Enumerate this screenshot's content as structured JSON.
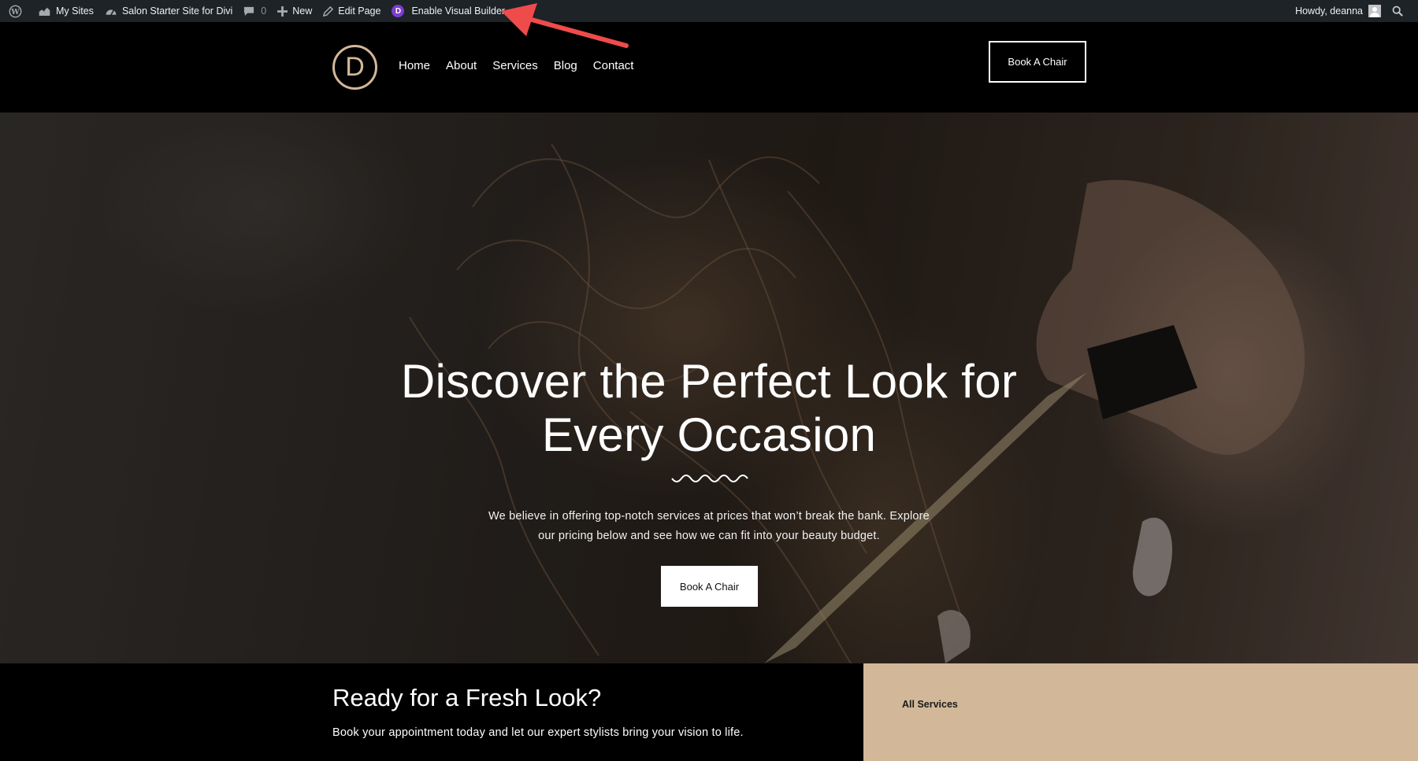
{
  "admin_bar": {
    "my_sites": "My Sites",
    "site_name": "Salon Starter Site for Divi",
    "comments_count": "0",
    "new": "New",
    "edit_page": "Edit Page",
    "divi_badge": "D",
    "visual_builder": "Enable Visual Builder",
    "greeting": "Howdy, deanna",
    "icons": [
      "wordpress-icon",
      "my-sites-icon",
      "dashboard-icon",
      "comment-icon",
      "plus-icon",
      "pencil-icon",
      "divi-icon",
      "avatar",
      "search-icon"
    ]
  },
  "annotation": {
    "color": "#ef4b4b",
    "shape": "arrow"
  },
  "header": {
    "logo_letter": "D",
    "nav": [
      "Home",
      "About",
      "Services",
      "Blog",
      "Contact"
    ],
    "cta": "Book A Chair",
    "accent": "#d2b898"
  },
  "hero": {
    "title_line1": "Discover the Perfect Look for",
    "title_line2": "Every Occasion",
    "text_line1": "We believe in offering top-notch services at prices that won’t break the bank. Explore",
    "text_line2": "our pricing below and see how we can fit into your beauty budget.",
    "cta": "Book A Chair"
  },
  "cta_section": {
    "title": "Ready for a Fresh Look?",
    "text": "Book your appointment today and let our expert stylists bring your vision to life.",
    "services_label": "All Services",
    "panel_color": "#d2b898"
  }
}
